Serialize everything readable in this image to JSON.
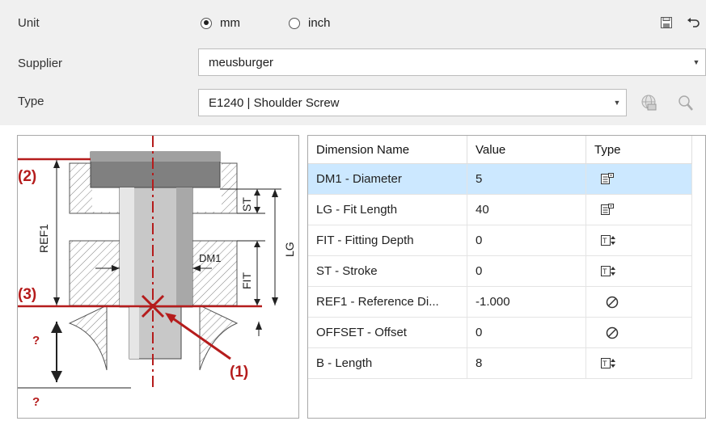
{
  "unit": {
    "label": "Unit",
    "options": [
      "mm",
      "inch"
    ],
    "selected": "mm"
  },
  "supplier": {
    "label": "Supplier",
    "value": "meusburger"
  },
  "type": {
    "label": "Type",
    "value": "E1240 | Shoulder Screw"
  },
  "toolbar": {
    "save_icon": "save-icon",
    "undo_icon": "undo-icon",
    "globe_icon": "globe-icon",
    "search_icon": "magnifier-icon"
  },
  "drawing": {
    "labels": {
      "l2": "(2)",
      "l3": "(3)",
      "l1": "(1)",
      "ref1": "REF1",
      "st": "ST",
      "lg": "LG",
      "dm1": "DM1",
      "fit": "FIT",
      "q1": "?",
      "q2": "?"
    }
  },
  "table": {
    "headers": [
      "Dimension Name",
      "Value",
      "Type"
    ],
    "rows": [
      {
        "name": "DM1 - Diameter",
        "value": "5",
        "type": "list-icon",
        "selected": true
      },
      {
        "name": "LG - Fit Length",
        "value": "40",
        "type": "list-icon",
        "selected": false
      },
      {
        "name": "FIT - Fitting Depth",
        "value": "0",
        "type": "spin-icon",
        "selected": false
      },
      {
        "name": "ST - Stroke",
        "value": "0",
        "type": "spin-icon",
        "selected": false
      },
      {
        "name": "REF1 - Reference Di...",
        "value": "-1.000",
        "type": "none-icon",
        "selected": false
      },
      {
        "name": "OFFSET - Offset",
        "value": "0",
        "type": "none-icon",
        "selected": false
      },
      {
        "name": "B - Length",
        "value": "8",
        "type": "spin-icon",
        "selected": false
      }
    ]
  },
  "colors": {
    "accent_red": "#b51c1c",
    "selection": "#cce8ff",
    "hatch": "#808080"
  }
}
